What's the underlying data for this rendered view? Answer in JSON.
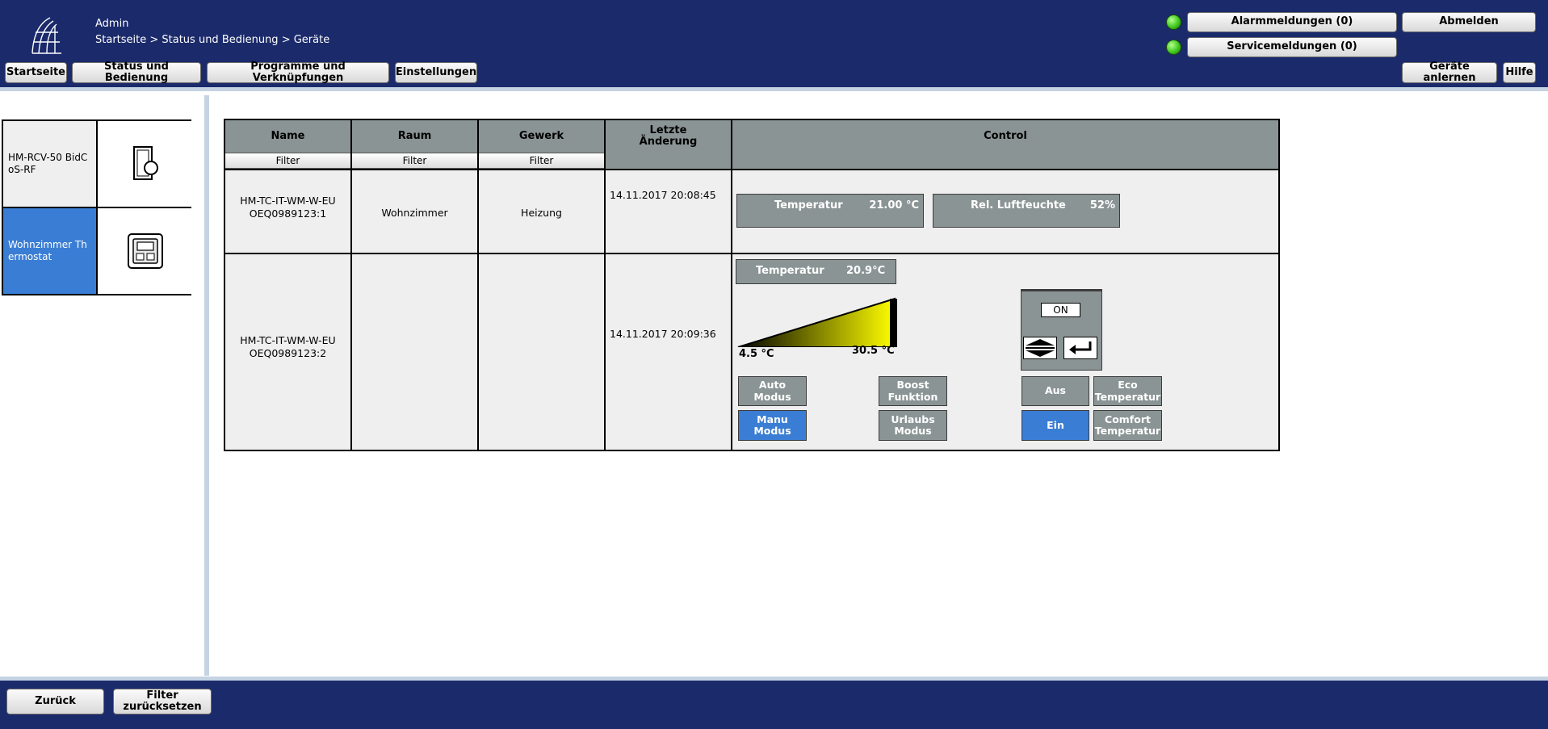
{
  "header": {
    "user": "Admin",
    "breadcrumb": "Startseite > Status und Bedienung > Geräte",
    "nav": [
      "Startseite",
      "Status und Bedienung",
      "Programme und Verknüpfungen",
      "Einstellungen"
    ],
    "alarm_label": "Alarmmeldungen (0)",
    "service_label": "Servicemeldungen (0)",
    "logout_label": "Abmelden",
    "teach_label": "Geräte anlernen",
    "help_label": "Hilfe"
  },
  "sidebar": {
    "devices": [
      {
        "label": "HM-RCV-50 BidCoS-RF",
        "icon": "remote-device-icon",
        "selected": false
      },
      {
        "label": "Wohnzimmer Thermostat",
        "icon": "thermostat-icon",
        "selected": true
      }
    ]
  },
  "table": {
    "headers": {
      "name": "Name",
      "room": "Raum",
      "trade": "Gewerk",
      "changed": "Letzte Änderung",
      "control": "Control"
    },
    "filter_label": "Filter",
    "rows": [
      {
        "name_line1": "HM-TC-IT-WM-W-EU",
        "name_line2": "OEQ0989123:1",
        "room": "Wohnzimmer",
        "trade": "Heizung",
        "changed": "14.11.2017 20:08:45",
        "temp_label": "Temperatur",
        "temp_value": "21.00 °C",
        "humidity_label": "Rel. Luftfeuchte",
        "humidity_value": "52%"
      },
      {
        "name_line1": "HM-TC-IT-WM-W-EU",
        "name_line2": "OEQ0989123:2",
        "room": "",
        "trade": "",
        "changed": "14.11.2017 20:09:36",
        "temp_label": "Temperatur",
        "temp_value": "20.9°C",
        "slider_min": "4.5 °C",
        "slider_max": "30.5 °C",
        "slider_level": 1.0,
        "on_value": "ON",
        "buttons": {
          "auto": "Auto Modus",
          "manu": "Manu Modus",
          "boost": "Boost Funktion",
          "urlaub": "Urlaubs Modus",
          "aus": "Aus",
          "ein": "Ein",
          "eco": "Eco Temperatur",
          "comfort": "Comfort Temperatur"
        },
        "active": [
          "manu",
          "ein"
        ]
      }
    ]
  },
  "footer": {
    "back_label": "Zurück",
    "reset_filter_label": "Filter zurücksetzen"
  },
  "colors": {
    "header_bg": "#1b2a6b",
    "cell_gray": "#8b9494",
    "active_blue": "#3a7dd4",
    "led_green": "#3fc81f",
    "slider_yellow": "#ffff00"
  }
}
